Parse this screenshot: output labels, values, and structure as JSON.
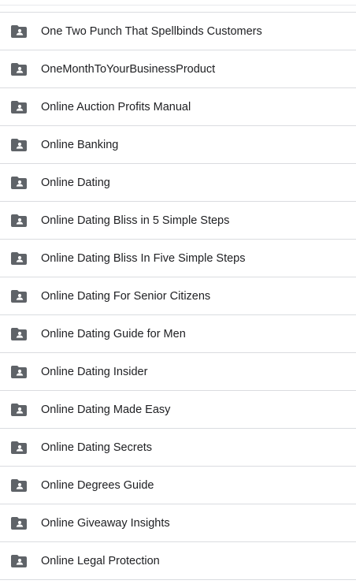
{
  "folder_list": {
    "icon": "shared-folder-icon",
    "icon_color": "#5f6368",
    "items": [
      {
        "label": "One Two Punch That Spellbinds Customers"
      },
      {
        "label": "OneMonthToYourBusinessProduct"
      },
      {
        "label": "Online Auction Profits Manual"
      },
      {
        "label": "Online Banking"
      },
      {
        "label": "Online Dating"
      },
      {
        "label": "Online Dating Bliss in 5 Simple Steps"
      },
      {
        "label": "Online Dating Bliss In Five Simple Steps"
      },
      {
        "label": "Online Dating For Senior Citizens"
      },
      {
        "label": "Online Dating Guide for Men"
      },
      {
        "label": "Online Dating Insider"
      },
      {
        "label": "Online Dating Made Easy"
      },
      {
        "label": "Online Dating Secrets"
      },
      {
        "label": "Online Degrees Guide"
      },
      {
        "label": "Online Giveaway Insights"
      },
      {
        "label": "Online Legal Protection"
      }
    ]
  }
}
